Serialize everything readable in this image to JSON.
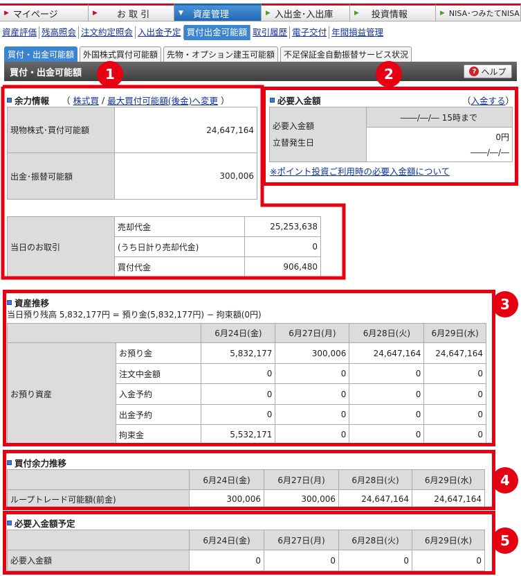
{
  "topnav": [
    {
      "label": "マイページ",
      "active": false
    },
    {
      "label": "お 取 引",
      "active": false
    },
    {
      "label": "資産管理",
      "active": true
    },
    {
      "label": "入出金･入出庫",
      "active": false
    },
    {
      "label": "投資情報",
      "active": false
    },
    {
      "label": "NISA･つみたてNISA",
      "active": false
    }
  ],
  "subnav": [
    "資産評価",
    "残高照会",
    "注文約定照会",
    "入出金予定",
    "買付出金可能額",
    "取引履歴",
    "電子交付",
    "年間損益管理"
  ],
  "tabs": [
    "買付・出金可能額",
    "外国株式買付可能額",
    "先物・オプション建玉可能額",
    "不足保証金自動振替サービス状況"
  ],
  "page_title": "買付・出金可能額",
  "help_label": "ヘルプ",
  "badges": [
    "1",
    "2",
    "3",
    "4",
    "5"
  ],
  "yoryoku": {
    "title": "余力情報",
    "paren_open": "（",
    "link1": "株式買",
    "sep": "/",
    "link2": "最大買付可能額(後金)へ変更",
    "paren_close": "）",
    "rows": [
      {
        "label": "現物株式･買付可能額",
        "value": "24,647,164"
      },
      {
        "label": "出金･振替可能額",
        "value": "300,006"
      }
    ],
    "today": {
      "label": "当日のお取引",
      "rows": [
        {
          "label": "売却代金",
          "value": "25,253,638"
        },
        {
          "label": "(うち日計り売却代金)",
          "value": "0"
        },
        {
          "label": "買付代金",
          "value": "906,480"
        }
      ]
    }
  },
  "hitsuyo": {
    "title": "必要入金額",
    "link": "入金する",
    "paren_open": "（",
    "paren_close": "）",
    "label1": "必要入金額",
    "label2": "立替発生日",
    "deadline": "――/―/― 15時まで",
    "amount": "0円",
    "date": "――/―/―",
    "note_link": "※ポイント投資ご利用時の必要入金額について"
  },
  "shisan": {
    "title": "資産推移",
    "summary": "当日預り残高 5,832,177円 = 預り金(5,832,177円) − 拘束額(0円)",
    "headers": [
      "6月24日(金)",
      "6月27日(月)",
      "6月28日(火)",
      "6月29日(水)"
    ],
    "group": "お預り資産",
    "rows": [
      {
        "label": "お預り金",
        "values": [
          "5,832,177",
          "300,006",
          "24,647,164",
          "24,647,164"
        ]
      },
      {
        "label": "注文中金額",
        "values": [
          "0",
          "0",
          "0",
          "0"
        ]
      },
      {
        "label": "入金予約",
        "values": [
          "0",
          "0",
          "0",
          "0"
        ]
      },
      {
        "label": "出金予約",
        "values": [
          "0",
          "0",
          "0",
          "0"
        ]
      },
      {
        "label": "拘束金",
        "values": [
          "5,532,171",
          "0",
          "0",
          "0"
        ]
      }
    ]
  },
  "kaitsuke": {
    "title": "買付余力推移",
    "headers": [
      "6月24日(金)",
      "6月27日(月)",
      "6月28日(火)",
      "6月29日(水)"
    ],
    "row": {
      "label": "ループトレード可能額(前金)",
      "values": [
        "300,006",
        "300,006",
        "24,647,164",
        "24,647,164"
      ]
    }
  },
  "yotei": {
    "title": "必要入金額予定",
    "headers": [
      "6月24日(金)",
      "6月27日(月)",
      "6月28日(火)",
      "6月29日(水)"
    ],
    "row": {
      "label": "必要入金額",
      "values": [
        "0",
        "0",
        "0",
        "0"
      ]
    }
  },
  "colors": {
    "accent_red": "#e60012",
    "nav_blue": "#1f68b3",
    "link": "#10329c"
  }
}
